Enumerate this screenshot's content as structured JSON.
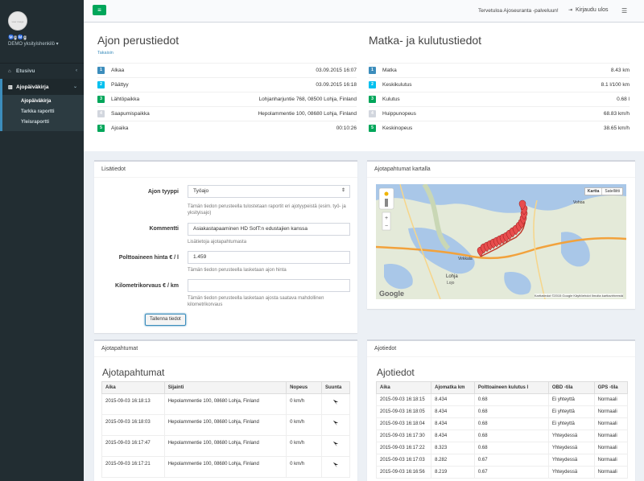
{
  "sidebar": {
    "avatar_text": "user image",
    "user_name": "Ⓜ️ǥ Ⓜ️ǥ",
    "user_role": "DEMO yksityishenkilö ▾",
    "items": [
      {
        "label": "Etusivu",
        "icon": "home-icon"
      },
      {
        "label": "Ajopäiväkirja",
        "icon": "chart-icon"
      }
    ],
    "subitems": [
      "Ajopäiväkirja",
      "Tarkka raportti",
      "Yleisraportti"
    ]
  },
  "header": {
    "menu_icon": "≡",
    "welcome": "Tervetuloa Ajoseuranta -palveluun!",
    "logout": "Kirjaudu ulos"
  },
  "trip": {
    "title": "Ajon perustiedot",
    "back": "Takaisin",
    "rows": [
      {
        "n": "1",
        "label": "Alkaa",
        "value": "03.09.2015 16:07",
        "color": "#3c8dbc"
      },
      {
        "n": "2",
        "label": "Päättyy",
        "value": "03.09.2015 16:18",
        "color": "#00c0ef"
      },
      {
        "n": "3",
        "label": "Lähtöpaikka",
        "value": "Lohjanharjuntie 768, 08500 Lohja, Finland",
        "color": "#00a65a"
      },
      {
        "n": "4",
        "label": "Saapumispaikka",
        "value": "Hepolammentie 100, 08680 Lohja, Finland",
        "color": "#d2d6de"
      },
      {
        "n": "5",
        "label": "Ajoaika",
        "value": "00:10:26",
        "color": "#00a65a"
      }
    ]
  },
  "consumption": {
    "title": "Matka- ja kulutustiedot",
    "rows": [
      {
        "n": "1",
        "label": "Matka",
        "value": "8.43 km",
        "color": "#3c8dbc"
      },
      {
        "n": "2",
        "label": "Keskikulutus",
        "value": "8.1 l/100 km",
        "color": "#00c0ef"
      },
      {
        "n": "3",
        "label": "Kulutus",
        "value": "0.68 l",
        "color": "#00a65a"
      },
      {
        "n": "4",
        "label": "Huippunopeus",
        "value": "68.83 km/h",
        "color": "#d2d6de"
      },
      {
        "n": "5",
        "label": "Keskinopeus",
        "value": "38.65 km/h",
        "color": "#00a65a"
      }
    ]
  },
  "details": {
    "title": "Lisätiedot",
    "trip_type_label": "Ajon tyyppi",
    "trip_type_value": "Työajo",
    "trip_type_help": "Tämän tiedon perusteella tulostetaan raportit eri ajotyypeistä (esim. työ- ja yksityisajo)",
    "comment_label": "Kommentti",
    "comment_value": "Asiakastapaaminen HD SofT:n edustajien kanssa",
    "comment_help": "Lisätietoja ajotapahtumasta",
    "fuel_label": "Polttoaineen hinta € / l",
    "fuel_value": "1.459",
    "fuel_help": "Tämän tiedon perusteella lasketaan ajon hinta",
    "km_label": "Kilometrikorvaus € / km",
    "km_value": "",
    "km_help": "Tämän tiedon perusteella lasketaan ajosta saatava mahdollinen kilometrikorvaus",
    "save": "Tallenna tiedot"
  },
  "map": {
    "title": "Ajotapahtumat kartalla",
    "btn_map": "Kartta",
    "btn_sat": "Satelliitti",
    "google": "Google",
    "attribution": "Karttatiedot ©2015 Google   Käyttöehdot   Ilmoita karttavirheestä",
    "places": [
      "Lohja",
      "Lojo",
      "Virkkala",
      "Vohoa"
    ]
  },
  "events": {
    "box_title": "Ajotapahtumat",
    "title": "Ajotapahtumat",
    "columns": [
      "Aika",
      "Sijainti",
      "Nopeus",
      "Suunta"
    ],
    "rows": [
      [
        "2015-09-03 16:18:13",
        "Hepolammentie 100, 08680 Lohja, Finland",
        "0 km/h"
      ],
      [
        "2015-09-03 16:18:03",
        "Hepolammentie 100, 08680 Lohja, Finland",
        "0 km/h"
      ],
      [
        "2015-09-03 16:17:47",
        "Hepolammentie 100, 08680 Lohja, Finland",
        "0 km/h"
      ],
      [
        "2015-09-03 16:17:21",
        "Hepolammentie 100, 08680 Lohja, Finland",
        "0 km/h"
      ]
    ]
  },
  "tripdata": {
    "box_title": "Ajotiedot",
    "title": "Ajotiedot",
    "columns": [
      "Aika",
      "Ajomatka km",
      "Polttoaineen kulutus l",
      "OBD -tila",
      "GPS -tila"
    ],
    "rows": [
      [
        "2015-09-03 16:18:15",
        "8.434",
        "0.68",
        "Ei yhteyttä",
        "Normaali"
      ],
      [
        "2015-09-03 16:18:05",
        "8.434",
        "0.68",
        "Ei yhteyttä",
        "Normaali"
      ],
      [
        "2015-09-03 16:18:04",
        "8.434",
        "0.68",
        "Ei yhteyttä",
        "Normaali"
      ],
      [
        "2015-09-03 16:17:30",
        "8.434",
        "0.68",
        "Yhteydessä",
        "Normaali"
      ],
      [
        "2015-09-03 16:17:22",
        "8.323",
        "0.68",
        "Yhteydessä",
        "Normaali"
      ],
      [
        "2015-09-03 16:17:03",
        "8.282",
        "0.67",
        "Yhteydessä",
        "Normaali"
      ],
      [
        "2015-09-03 16:16:56",
        "8.219",
        "0.67",
        "Yhteydessä",
        "Normaali"
      ]
    ]
  }
}
